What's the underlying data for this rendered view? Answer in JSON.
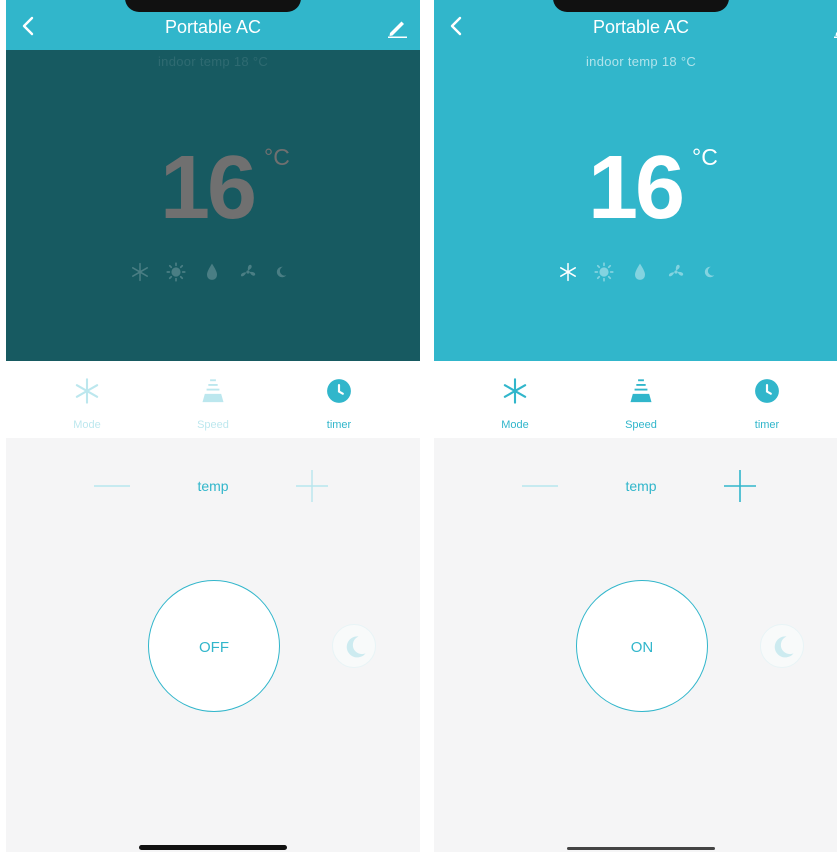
{
  "colors": {
    "accent": "#31b6cb",
    "dim_overlay": "#175a61",
    "panel_background": "#f5f5f6",
    "tab_background": "#ffffff"
  },
  "screens": [
    {
      "state": "off",
      "header": {
        "title": "Portable AC",
        "back_icon": "chevron-left-icon",
        "edit_icon": "pencil-icon"
      },
      "indoor_temp_label": "indoor temp 18 °C",
      "set_temperature": "16",
      "unit": "°C",
      "mode_icons": [
        "snowflake-icon",
        "sun-icon",
        "droplet-icon",
        "fan-icon",
        "moon-icon"
      ],
      "tabs": [
        {
          "label": "Mode",
          "icon": "snowflake-icon"
        },
        {
          "label": "Speed",
          "icon": "fan-speed-icon"
        },
        {
          "label": "timer",
          "icon": "clock-icon"
        }
      ],
      "temp_control": {
        "label": "temp",
        "minus_icon": "minus-icon",
        "plus_icon": "plus-icon"
      },
      "power_button": {
        "label": "OFF"
      },
      "sleep_icon": "moon-icon"
    },
    {
      "state": "on",
      "header": {
        "title": "Portable AC",
        "back_icon": "chevron-left-icon",
        "edit_icon": "pencil-icon"
      },
      "indoor_temp_label": "indoor temp 18 °C",
      "set_temperature": "16",
      "unit": "°C",
      "mode_icons": [
        "snowflake-icon",
        "sun-icon",
        "droplet-icon",
        "fan-icon",
        "moon-icon"
      ],
      "tabs": [
        {
          "label": "Mode",
          "icon": "snowflake-icon"
        },
        {
          "label": "Speed",
          "icon": "fan-speed-icon"
        },
        {
          "label": "timer",
          "icon": "clock-icon"
        }
      ],
      "temp_control": {
        "label": "temp",
        "minus_icon": "minus-icon",
        "plus_icon": "plus-icon"
      },
      "power_button": {
        "label": "ON"
      },
      "sleep_icon": "moon-icon"
    }
  ]
}
